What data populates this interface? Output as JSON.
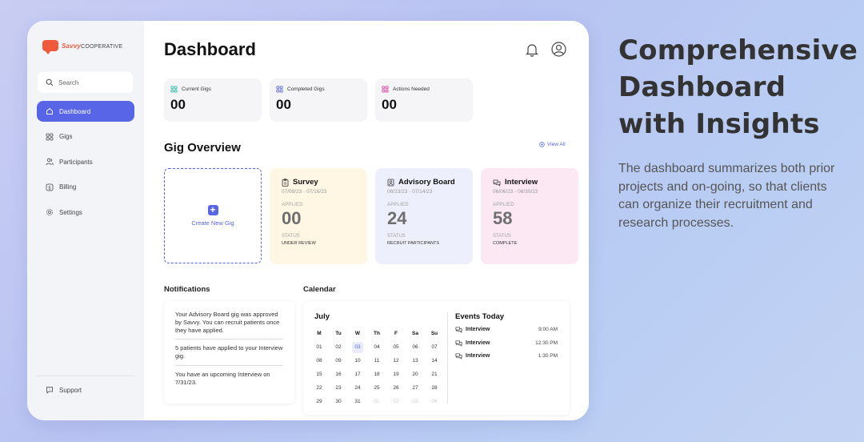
{
  "marketing": {
    "headline": "Comprehensive Dashboard with Insights",
    "description": "The dashboard summarizes both prior projects and on-going, so that clients can organize their recruitment and research processes."
  },
  "brand": {
    "name_part1": "Savvy",
    "name_part2": "COOPERATIVE",
    "color": "#f05a3c"
  },
  "sidebar": {
    "search_placeholder": "Search",
    "items": [
      {
        "label": "Dashboard",
        "icon": "home-icon",
        "active": true
      },
      {
        "label": "Gigs",
        "icon": "grid-icon"
      },
      {
        "label": "Participants",
        "icon": "people-icon"
      },
      {
        "label": "Billing",
        "icon": "dollar-icon"
      },
      {
        "label": "Settings",
        "icon": "gear-icon"
      }
    ],
    "support_label": "Support"
  },
  "header": {
    "title": "Dashboard"
  },
  "stats": [
    {
      "label": "Current Gigs",
      "value": "00",
      "color": "#25b8a8"
    },
    {
      "label": "Completed Gigs",
      "value": "00",
      "color": "#5865e6"
    },
    {
      "label": "Actions Needed",
      "value": "00",
      "color": "#e2389a"
    }
  ],
  "gig_overview": {
    "title": "Gig Overview",
    "view_all": "View All",
    "create_label": "Create New Gig",
    "applied_label": "APPLIED",
    "status_label": "STATUS",
    "gigs": [
      {
        "name": "Survey",
        "dates": "07/09/23 - 07/16/23",
        "applied": "00",
        "status": "UNDER REVIEW",
        "bg": "#fff7e3"
      },
      {
        "name": "Advisory Board",
        "dates": "06/23/23 - 07/14/23",
        "applied": "24",
        "status": "RECRUIT PARTICIPANTS",
        "bg": "#eeeffc"
      },
      {
        "name": "Interview",
        "dates": "06/06/23 - 06/30/23",
        "applied": "58",
        "status": "COMPLETE",
        "bg": "#fbe8f3"
      }
    ]
  },
  "notifications": {
    "title": "Notifications",
    "items": [
      "Your Advisory Board gig was approved by Savvy. You can recruit patients once they have applied.",
      "5 patients have applied to your Interview gig.",
      "You have an upcoming Interview on 7/31/23."
    ]
  },
  "calendar": {
    "title": "Calendar",
    "month": "July",
    "weekdays": [
      "M",
      "Tu",
      "W",
      "Th",
      "F",
      "Sa",
      "Su"
    ],
    "weeks": [
      [
        "01",
        "02",
        "03",
        "04",
        "05",
        "06",
        "07"
      ],
      [
        "08",
        "09",
        "10",
        "11",
        "12",
        "13",
        "14"
      ],
      [
        "15",
        "16",
        "17",
        "18",
        "19",
        "20",
        "21"
      ],
      [
        "22",
        "23",
        "24",
        "25",
        "26",
        "27",
        "28"
      ],
      [
        "29",
        "30",
        "31",
        "01",
        "02",
        "03",
        "04"
      ]
    ],
    "today": "03",
    "events_title": "Events Today",
    "events": [
      {
        "name": "Interview",
        "time": "9:00 AM"
      },
      {
        "name": "Interview",
        "time": "12:30 PM"
      },
      {
        "name": "Interview",
        "time": "1:30 PM"
      }
    ]
  }
}
